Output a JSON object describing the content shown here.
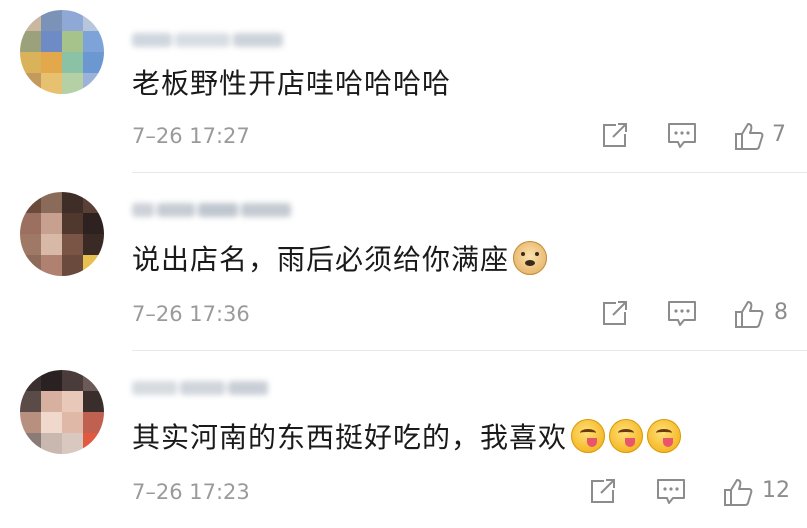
{
  "comments": [
    {
      "text": "老板野性开店哇哈哈哈哈",
      "time": "7–26 17:27",
      "likes": "7",
      "emojis": []
    },
    {
      "text": "说出店名，雨后必须给你满座",
      "time": "7–26 17:36",
      "likes": "8",
      "emojis": [
        "doge-emoji"
      ]
    },
    {
      "text": "其实河南的东西挺好吃的，我喜欢",
      "time": "7–26 17:23",
      "likes": "12",
      "emojis": [
        "tongue-emoji",
        "tongue-emoji",
        "tongue-emoji"
      ]
    }
  ],
  "icons": {
    "share": "share-icon",
    "comment": "comment-icon",
    "like": "thumbs-up-icon"
  },
  "colors": {
    "text": "#1a1a1a",
    "meta": "#9a9a9a",
    "icon": "#8c8c8c",
    "divider": "#e8e8e8"
  }
}
